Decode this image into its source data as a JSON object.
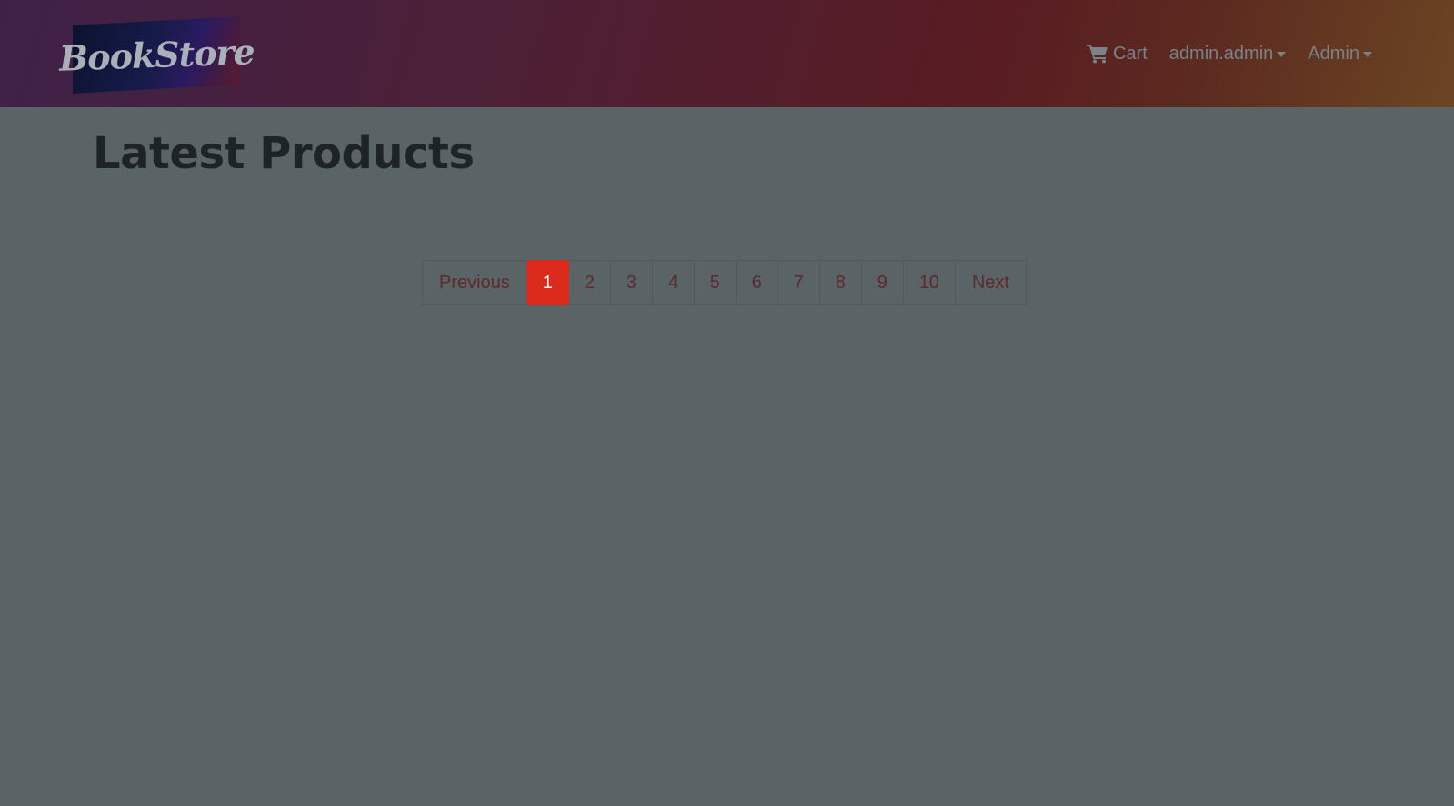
{
  "header": {
    "brand": "BookStore",
    "nav": {
      "cart_label": "Cart",
      "cart_icon": "shopping-cart-icon",
      "user_label": "admin.admin",
      "admin_label": "Admin"
    }
  },
  "main": {
    "title": "Latest Products"
  },
  "pagination": {
    "previous": "Previous",
    "pages": [
      "1",
      "2",
      "3",
      "4",
      "5",
      "6",
      "7",
      "8",
      "9",
      "10"
    ],
    "current": "1",
    "next": "Next"
  },
  "colors": {
    "accent": "#db2a1b",
    "background": "#5a6366"
  }
}
